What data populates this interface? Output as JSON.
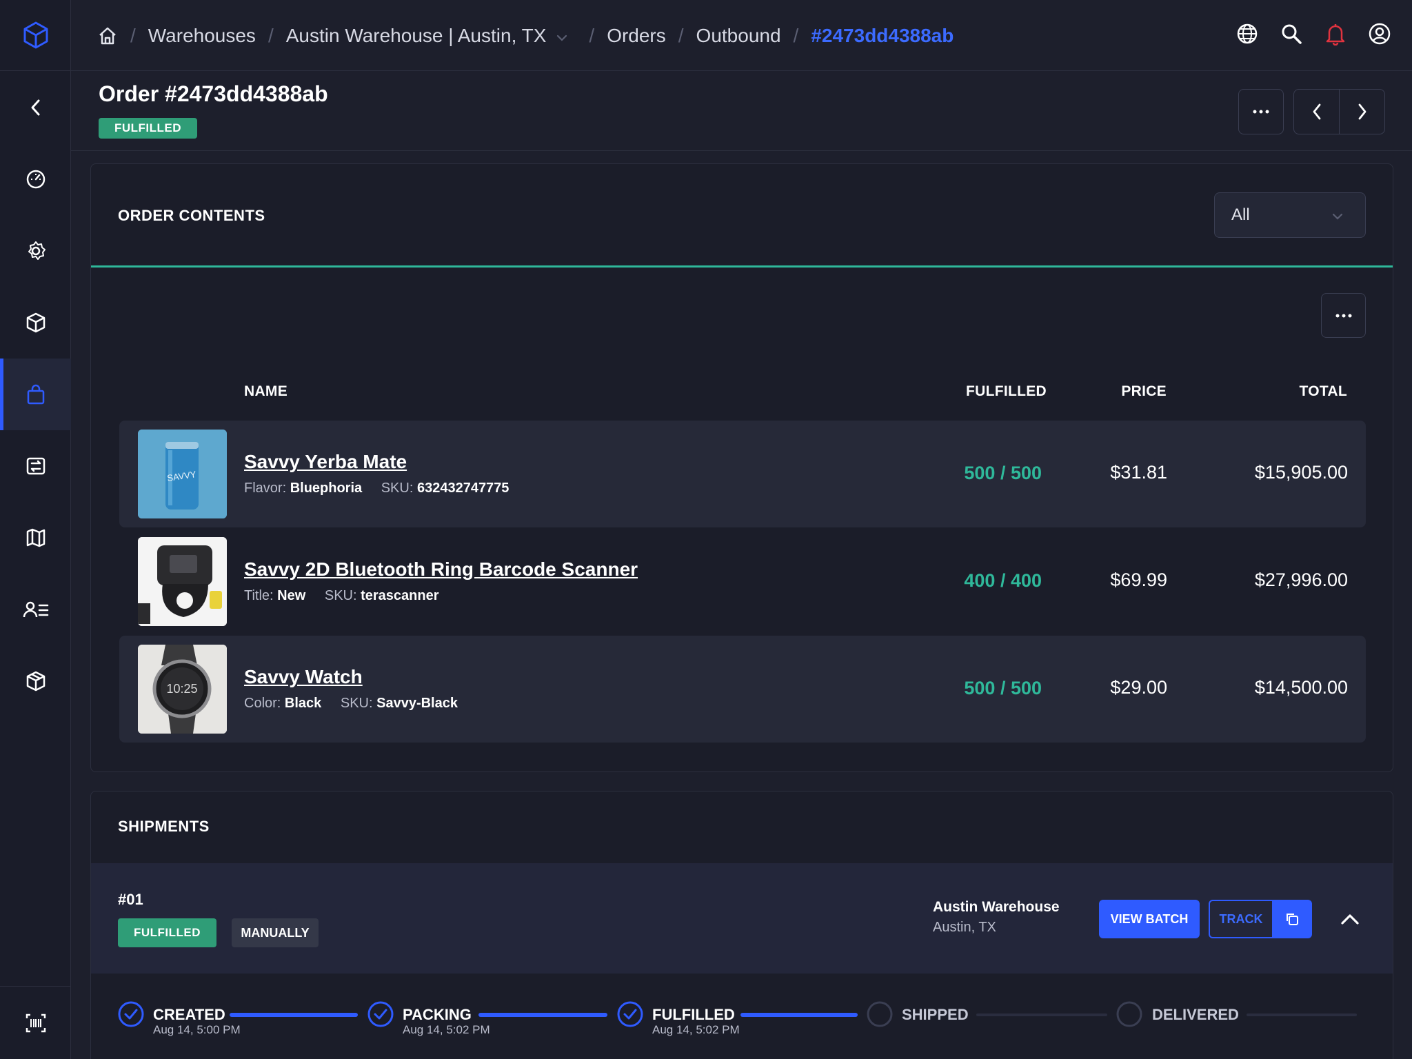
{
  "breadcrumbs": {
    "items": [
      "Warehouses",
      "Austin Warehouse | Austin, TX",
      "Orders",
      "Outbound"
    ],
    "current": "#2473dd4388ab"
  },
  "header": {
    "title": "Order #2473dd4388ab",
    "status": "FULFILLED"
  },
  "order_contents": {
    "title": "ORDER CONTENTS",
    "filter_value": "All",
    "columns": [
      "NAME",
      "FULFILLED",
      "PRICE",
      "TOTAL"
    ],
    "rows": [
      {
        "name": "Savvy Yerba Mate",
        "attr_label": "Flavor:",
        "attr_value": "Bluephoria",
        "sku_label": "SKU:",
        "sku": "632432747775",
        "fulfilled": "500 / 500",
        "price": "$31.81",
        "total": "$15,905.00",
        "thumb_text": "SAVVY"
      },
      {
        "name": "Savvy 2D Bluetooth Ring Barcode Scanner",
        "attr_label": "Title:",
        "attr_value": "New",
        "sku_label": "SKU:",
        "sku": "terascanner",
        "fulfilled": "400 / 400",
        "price": "$69.99",
        "total": "$27,996.00"
      },
      {
        "name": "Savvy Watch",
        "attr_label": "Color:",
        "attr_value": "Black",
        "sku_label": "SKU:",
        "sku": "Savvy-Black",
        "fulfilled": "500 / 500",
        "price": "$29.00",
        "total": "$14,500.00",
        "thumb_text": "10:25"
      }
    ]
  },
  "shipments": {
    "title": "SHIPMENTS",
    "shipment": {
      "number": "#01",
      "status": "FULFILLED",
      "method": "MANUALLY",
      "warehouse_name": "Austin Warehouse",
      "warehouse_location": "Austin, TX",
      "view_batch_label": "VIEW BATCH",
      "track_label": "TRACK"
    },
    "steps": [
      {
        "label": "CREATED",
        "time": "Aug 14, 5:00 PM",
        "done": true
      },
      {
        "label": "PACKING",
        "time": "Aug 14, 5:02 PM",
        "done": true
      },
      {
        "label": "FULFILLED",
        "time": "Aug 14, 5:02 PM",
        "done": true
      },
      {
        "label": "SHIPPED",
        "time": "",
        "done": false
      },
      {
        "label": "DELIVERED",
        "time": "",
        "done": false
      }
    ]
  },
  "colors": {
    "accent": "#2f5bff",
    "success": "#2f9d77",
    "teal": "#2fb89a",
    "alert": "#e0333f",
    "background": "#1d1f2c"
  },
  "icons": {
    "logo": "cube-logo-icon",
    "sidebar": [
      "collapse-chevron-icon",
      "dashboard-gauge-icon",
      "settings-gear-icon",
      "box-icon",
      "shopping-bag-icon",
      "transfer-icon",
      "map-icon",
      "user-list-icon",
      "package-icon",
      "barcode-scan-icon"
    ],
    "topbar": [
      "home-icon",
      "language-globe-icon",
      "search-icon",
      "notification-bell-icon",
      "account-icon"
    ]
  }
}
